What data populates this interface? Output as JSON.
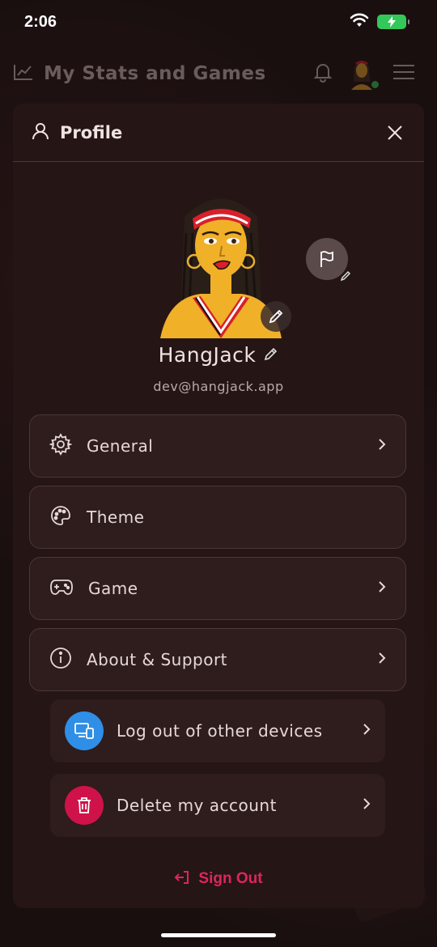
{
  "status_bar": {
    "time": "2:06"
  },
  "app_header": {
    "title": "My Stats and Games"
  },
  "panel": {
    "title": "Profile"
  },
  "profile": {
    "username": "HangJack",
    "email": "dev@hangjack.app"
  },
  "menu": [
    {
      "label": "General",
      "icon": "gear-icon",
      "has_chevron": true
    },
    {
      "label": "Theme",
      "icon": "palette-icon",
      "has_chevron": false
    },
    {
      "label": "Game",
      "icon": "gamepad-icon",
      "has_chevron": true
    },
    {
      "label": "About & Support",
      "icon": "info-icon",
      "has_chevron": true
    }
  ],
  "sub_actions": [
    {
      "label": "Log out of other devices",
      "icon": "devices-icon",
      "color": "#2f8fe6"
    },
    {
      "label": "Delete my account",
      "icon": "trash-icon",
      "color": "#d0124a"
    }
  ],
  "signout": {
    "label": "Sign Out",
    "color": "#e0245e"
  },
  "colors": {
    "background": "#1a0f0f",
    "panel": "#261616",
    "accent": "#e0245e",
    "battery": "#34c759"
  }
}
